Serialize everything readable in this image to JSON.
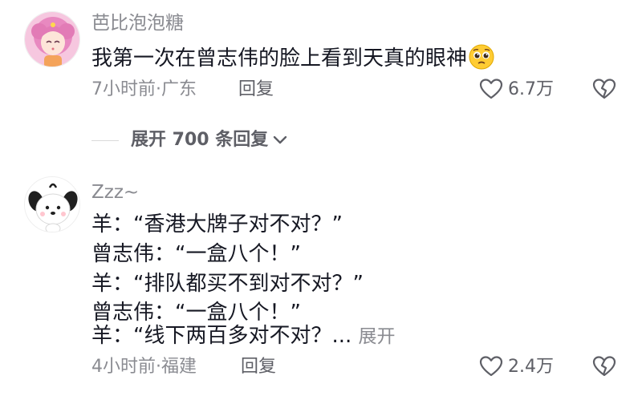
{
  "comments": [
    {
      "username": "芭比泡泡糖",
      "content": "我第一次在曾志伟的脸上看到天真的眼神",
      "emoji_icon": "pleading-face-emoji",
      "time_location": "7小时前·广东",
      "reply_label": "回复",
      "like_count": "6.7万",
      "avatar_icon": "anime-girl-pink-hair-avatar"
    },
    {
      "username": "Zzz~",
      "content_lines": [
        "羊：“香港大牌子对不对？”",
        "曾志伟：“一盒八个！”",
        "羊：“排队都买不到对不对？”",
        "曾志伟：“一盒八个！”",
        "羊：“线下两百多对不对？..."
      ],
      "expand_label": "展开",
      "time_location": "4小时前·福建",
      "reply_label": "回复",
      "like_count": "2.4万",
      "avatar_icon": "white-puppy-cartoon-avatar"
    }
  ],
  "expand_replies_label": "展开 700 条回复",
  "icons": {
    "like": "heart-outline-icon",
    "dislike": "broken-heart-icon",
    "chevron": "chevron-down-icon"
  }
}
